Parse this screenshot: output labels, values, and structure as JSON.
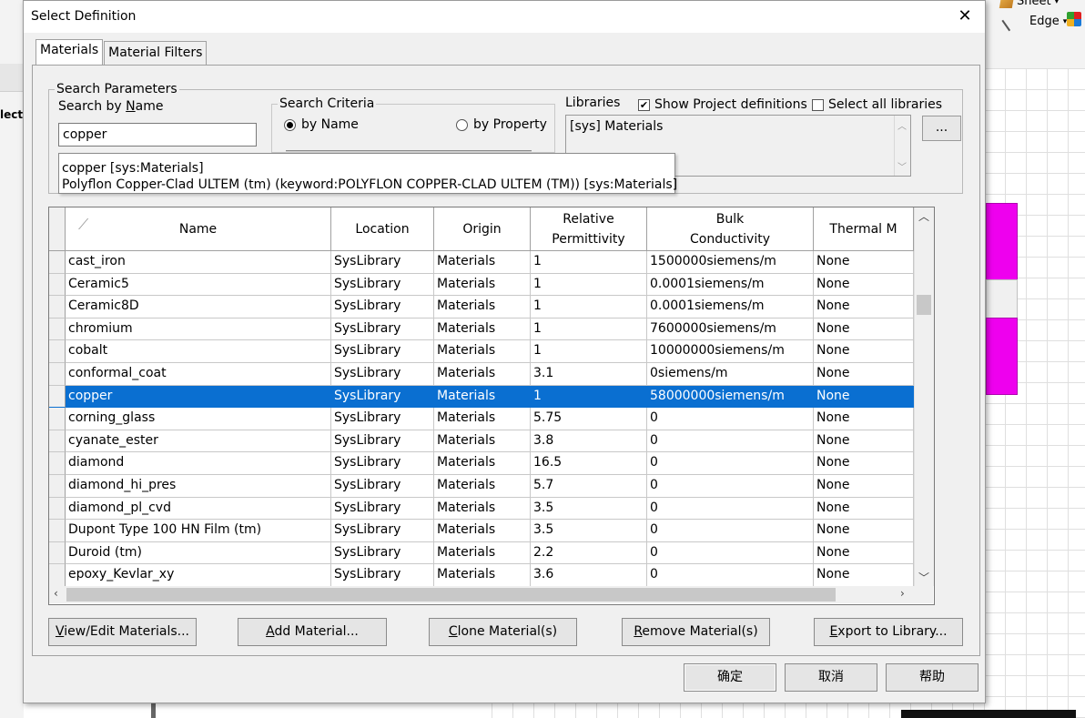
{
  "background": {
    "toolbar": {
      "sheet_label": "Sheet",
      "edge_label": "Edge"
    },
    "left_text": "lect"
  },
  "dialog": {
    "title": "Select Definition",
    "close_glyph": "✕",
    "tabs": [
      {
        "label": "Materials"
      },
      {
        "label": "Material Filters"
      }
    ],
    "search_params": {
      "legend": "Search Parameters",
      "search_by_name_prefix": "Search by ",
      "search_by_name_access": "N",
      "search_by_name_suffix": "ame",
      "search_value": "copper",
      "criteria_legend": "Search Criteria",
      "by_name_label": "by Name",
      "by_property_label": "by Property"
    },
    "libraries": {
      "label": "Libraries",
      "show_project_label": "Show Project definitions",
      "show_project_checked": "✔",
      "select_all_label": "Select all libraries",
      "items": [
        "[sys] Materials"
      ],
      "more_button": "..."
    },
    "suggestions": [
      "copper [sys:Materials]",
      "Polyflon Copper-Clad ULTEM (tm) (keyword:POLYFLON COPPER-CLAD ULTEM (TM)) [sys:Materials]"
    ],
    "grid": {
      "columns": [
        "Name",
        "Location",
        "Origin",
        "Relative\nPermittivity",
        "Bulk\nConductivity",
        "Thermal M"
      ],
      "rows": [
        [
          "cast_iron",
          "SysLibrary",
          "Materials",
          "1",
          "1500000siemens/m",
          "None"
        ],
        [
          "Ceramic5",
          "SysLibrary",
          "Materials",
          "1",
          "0.0001siemens/m",
          "None"
        ],
        [
          "Ceramic8D",
          "SysLibrary",
          "Materials",
          "1",
          "0.0001siemens/m",
          "None"
        ],
        [
          "chromium",
          "SysLibrary",
          "Materials",
          "1",
          "7600000siemens/m",
          "None"
        ],
        [
          "cobalt",
          "SysLibrary",
          "Materials",
          "1",
          "10000000siemens/m",
          "None"
        ],
        [
          "conformal_coat",
          "SysLibrary",
          "Materials",
          "3.1",
          "0siemens/m",
          "None"
        ],
        [
          "copper",
          "SysLibrary",
          "Materials",
          "1",
          "58000000siemens/m",
          "None"
        ],
        [
          "corning_glass",
          "SysLibrary",
          "Materials",
          "5.75",
          "0",
          "None"
        ],
        [
          "cyanate_ester",
          "SysLibrary",
          "Materials",
          "3.8",
          "0",
          "None"
        ],
        [
          "diamond",
          "SysLibrary",
          "Materials",
          "16.5",
          "0",
          "None"
        ],
        [
          "diamond_hi_pres",
          "SysLibrary",
          "Materials",
          "5.7",
          "0",
          "None"
        ],
        [
          "diamond_pl_cvd",
          "SysLibrary",
          "Materials",
          "3.5",
          "0",
          "None"
        ],
        [
          "Dupont Type 100 HN Film (tm)",
          "SysLibrary",
          "Materials",
          "3.5",
          "0",
          "None"
        ],
        [
          "Duroid (tm)",
          "SysLibrary",
          "Materials",
          "2.2",
          "0",
          "None"
        ],
        [
          "epoxy_Kevlar_xy",
          "SysLibrary",
          "Materials",
          "3.6",
          "0",
          "None"
        ]
      ],
      "selected_row": 6
    },
    "action_buttons": [
      {
        "access": "V",
        "rest": "iew/Edit Materials..."
      },
      {
        "access": "A",
        "rest": "dd Material..."
      },
      {
        "access": "C",
        "rest": "lone Material(s)"
      },
      {
        "access": "R",
        "rest": "emove Material(s)"
      },
      {
        "access": "E",
        "rest": "xport to Library..."
      }
    ],
    "footer_buttons": {
      "ok": "确定",
      "cancel": "取消",
      "help": "帮助"
    }
  },
  "colors": {
    "selection": "#0a6fd1",
    "magenta_shapes": "#ee00ee",
    "dialog_bg": "#f0f0f0"
  }
}
